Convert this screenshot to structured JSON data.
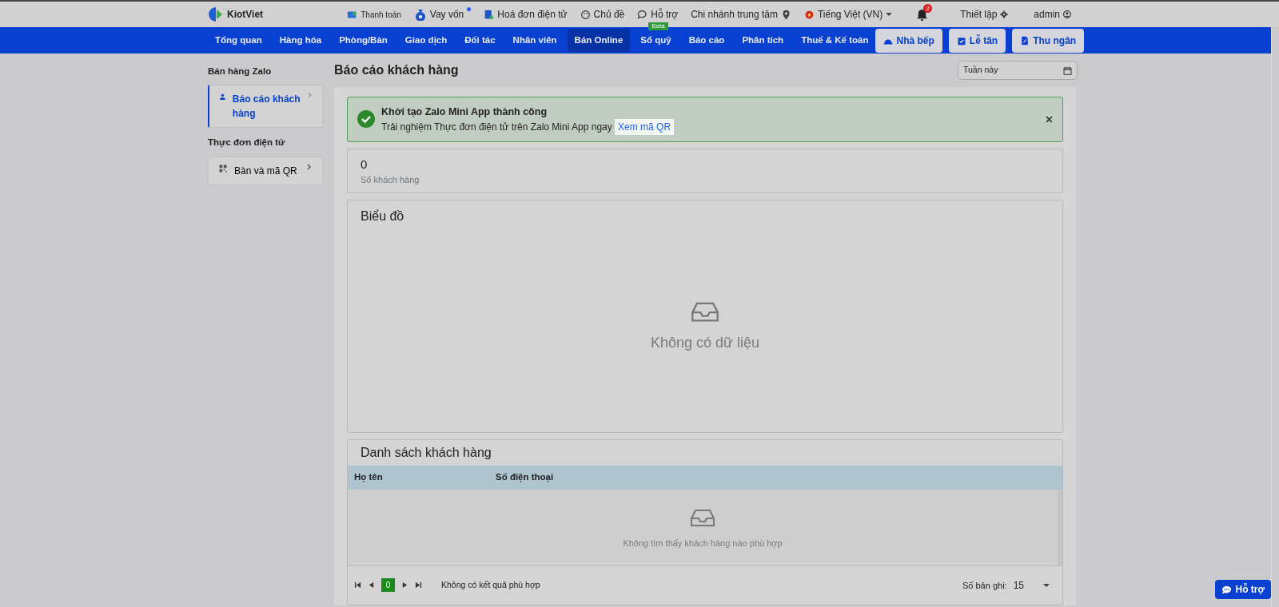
{
  "topbar": {
    "logo": "KiotViet",
    "links": [
      {
        "label": "Thanh toán"
      },
      {
        "label": "Vay vốn",
        "dot": true
      },
      {
        "label": "Hoá đơn điện tử"
      },
      {
        "label": "Chủ đề"
      },
      {
        "label": "Hỗ trợ",
        "badge": "Beta"
      },
      {
        "label": "Chi nhánh trung tâm"
      },
      {
        "label": "Tiếng Việt (VN)"
      }
    ],
    "notifications": "2",
    "settings": "Thiết lập",
    "user": "admin"
  },
  "nav": {
    "items": [
      {
        "label": "Tổng quan",
        "selected": false
      },
      {
        "label": "Hàng hóa",
        "selected": false
      },
      {
        "label": "Phòng/Bàn",
        "selected": false
      },
      {
        "label": "Giao dịch",
        "selected": false
      },
      {
        "label": "Đối tác",
        "selected": false
      },
      {
        "label": "Nhân viên",
        "selected": false
      },
      {
        "label": "Bán Online",
        "selected": true
      },
      {
        "label": "Sổ quỹ",
        "selected": false
      },
      {
        "label": "Báo cáo",
        "selected": false
      },
      {
        "label": "Phân tích",
        "selected": false
      },
      {
        "label": "Thuế & Kế toán",
        "selected": false
      }
    ],
    "buttons": [
      {
        "label": "Nhà bếp"
      },
      {
        "label": "Lễ tân"
      },
      {
        "label": "Thu ngân"
      }
    ]
  },
  "sidebar": {
    "groups": [
      {
        "title": "Bán hàng Zalo",
        "items": [
          {
            "label": "Báo cáo khách hàng",
            "selected": true
          }
        ]
      },
      {
        "title": "Thực đơn điện tử",
        "items": [
          {
            "label": "Bàn và mã QR",
            "selected": false
          }
        ]
      }
    ]
  },
  "page": {
    "title": "Báo cáo khách hàng",
    "period": "Tuần này"
  },
  "alert": {
    "title": "Khởi tạo Zalo Mini App thành công",
    "message": "Trải nghiệm Thực đơn điện tử trên Zalo Mini App ngay",
    "link": "Xem mã QR"
  },
  "stat": {
    "value": "0",
    "label": "Số khách hàng"
  },
  "chart_card": {
    "title": "Biểu đồ",
    "empty": "Không có dữ liệu"
  },
  "table": {
    "title": "Danh sách khách hàng",
    "columns": [
      "Họ tên",
      "Số điện thoại"
    ],
    "empty": "Không tìm thấy khách hàng nào phù hợp",
    "pagination": {
      "page": "0",
      "status": "Không có kết quả phù hợp",
      "size_label": "Số bản ghi:",
      "size": "15"
    }
  },
  "help_button": "Hỗ trợ"
}
